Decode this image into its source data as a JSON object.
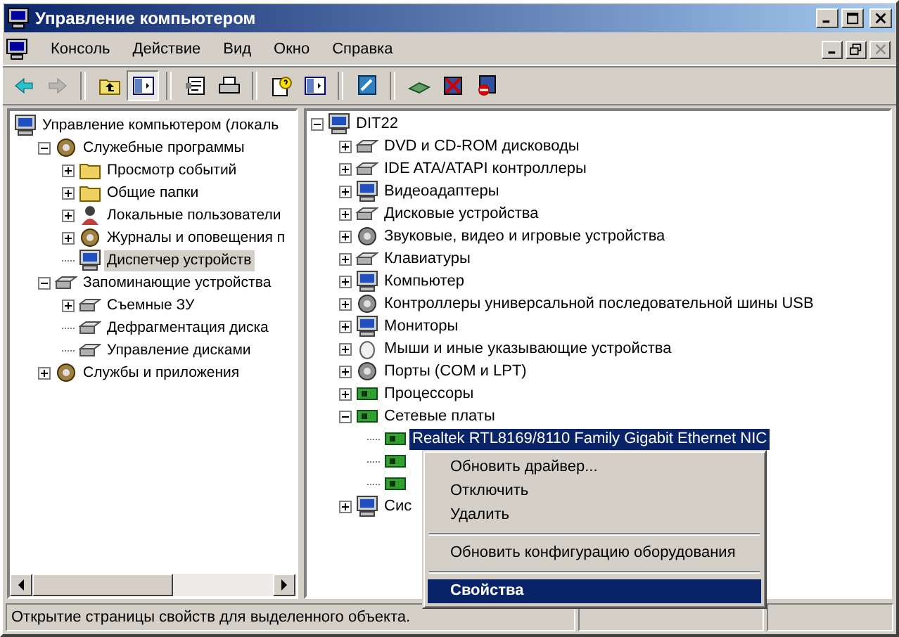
{
  "window": {
    "title": "Управление компьютером"
  },
  "menu": [
    "Консоль",
    "Действие",
    "Вид",
    "Окно",
    "Справка"
  ],
  "toolbar": [
    {
      "kind": "back",
      "disabled": false,
      "pressed": false
    },
    {
      "kind": "forward",
      "disabled": true,
      "pressed": false
    },
    {
      "kind": "separator"
    },
    {
      "kind": "up",
      "disabled": false,
      "pressed": false
    },
    {
      "kind": "tree",
      "disabled": false,
      "pressed": true
    },
    {
      "kind": "separator"
    },
    {
      "kind": "properties",
      "disabled": false,
      "pressed": false
    },
    {
      "kind": "print",
      "disabled": false,
      "pressed": false
    },
    {
      "kind": "separator"
    },
    {
      "kind": "help",
      "disabled": false,
      "pressed": false
    },
    {
      "kind": "pane",
      "disabled": false,
      "pressed": false
    },
    {
      "kind": "separator"
    },
    {
      "kind": "scan",
      "disabled": false,
      "pressed": false
    },
    {
      "kind": "separator"
    },
    {
      "kind": "network",
      "disabled": false,
      "pressed": false
    },
    {
      "kind": "uninstall",
      "disabled": false,
      "pressed": false
    },
    {
      "kind": "disable",
      "disabled": false,
      "pressed": false
    }
  ],
  "console_tree": [
    {
      "label": "Управление компьютером (локаль",
      "kind": "computer",
      "selected": false,
      "children": [
        {
          "label": "Служебные программы",
          "kind": "tools",
          "expanded": true,
          "selected": false,
          "children": [
            {
              "label": "Просмотр событий",
              "kind": "events",
              "expanded": false,
              "selected": false
            },
            {
              "label": "Общие папки",
              "kind": "folder",
              "expanded": false,
              "selected": false
            },
            {
              "label": "Локальные пользователи",
              "kind": "users",
              "expanded": false,
              "selected": false
            },
            {
              "label": "Журналы и оповещения п",
              "kind": "logs",
              "expanded": false,
              "selected": false
            },
            {
              "label": "Диспетчер устройств",
              "kind": "computer",
              "selected": true
            }
          ]
        },
        {
          "label": "Запоминающие устройства",
          "kind": "storage",
          "expanded": true,
          "selected": false,
          "children": [
            {
              "label": "Съемные ЗУ",
              "kind": "removable",
              "expanded": false,
              "selected": false
            },
            {
              "label": "Дефрагментация диска",
              "kind": "defrag",
              "selected": false
            },
            {
              "label": "Управление дисками",
              "kind": "disk",
              "selected": false
            }
          ]
        },
        {
          "label": "Службы и приложения",
          "kind": "services",
          "expanded": false,
          "selected": false
        }
      ]
    }
  ],
  "device_tree": [
    {
      "label": "DIT22",
      "kind": "computer",
      "expanded": true,
      "selected": false,
      "children": [
        {
          "label": "DVD и CD-ROM дисководы",
          "kind": "dvd",
          "expanded": false,
          "selected": false
        },
        {
          "label": "IDE ATA/ATAPI контроллеры",
          "kind": "disk",
          "expanded": false,
          "selected": false
        },
        {
          "label": "Видеоадаптеры",
          "kind": "display",
          "expanded": false,
          "selected": false
        },
        {
          "label": "Дисковые устройства",
          "kind": "disk",
          "expanded": false,
          "selected": false
        },
        {
          "label": "Звуковые, видео и игровые устройства",
          "kind": "sound",
          "expanded": false,
          "selected": false
        },
        {
          "label": "Клавиатуры",
          "kind": "keyboard",
          "expanded": false,
          "selected": false
        },
        {
          "label": "Компьютер",
          "kind": "display",
          "expanded": false,
          "selected": false
        },
        {
          "label": "Контроллеры универсальной последовательной шины USB",
          "kind": "usb",
          "expanded": false,
          "selected": false
        },
        {
          "label": "Мониторы",
          "kind": "display",
          "expanded": false,
          "selected": false
        },
        {
          "label": "Мыши и иные указывающие устройства",
          "kind": "mouse",
          "expanded": false,
          "selected": false
        },
        {
          "label": "Порты (COM и LPT)",
          "kind": "port",
          "expanded": false,
          "selected": false
        },
        {
          "label": "Процессоры",
          "kind": "cpu",
          "expanded": false,
          "selected": false
        },
        {
          "label": "Сетевые платы",
          "kind": "network",
          "expanded": true,
          "selected": false,
          "children": [
            {
              "label": "Realtek RTL8169/8110 Family Gigabit Ethernet NIC",
              "kind": "network",
              "selected": true
            },
            {
              "kind": "network",
              "selected": false
            },
            {
              "kind": "network",
              "selected": false
            }
          ]
        },
        {
          "label": "Сис",
          "kind": "display",
          "expanded": false,
          "selected": false
        }
      ]
    }
  ],
  "context_menu": [
    {
      "kind": "item",
      "label": "Обновить драйвер...",
      "selected": false,
      "default": false
    },
    {
      "kind": "item",
      "label": "Отключить",
      "selected": false,
      "default": false
    },
    {
      "kind": "item",
      "label": "Удалить",
      "selected": false,
      "default": false
    },
    {
      "kind": "separator"
    },
    {
      "kind": "item",
      "label": "Обновить конфигурацию оборудования",
      "selected": false,
      "default": false
    },
    {
      "kind": "separator"
    },
    {
      "kind": "item",
      "label": "Свойства",
      "selected": true,
      "default": true
    }
  ],
  "status_bar": {
    "text": "Открытие страницы свойств для выделенного объекта."
  }
}
